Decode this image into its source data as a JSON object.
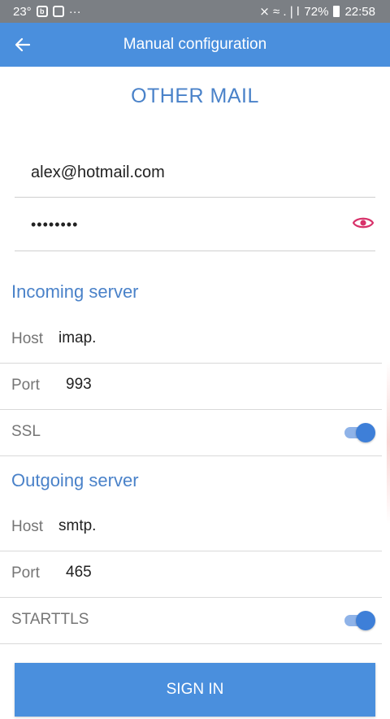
{
  "status_bar": {
    "temperature": "23°",
    "dots": "···",
    "signal": "⨯ ≈ .❘l",
    "battery": "72%",
    "time": "22:58"
  },
  "app_bar": {
    "back_icon": "arrow-left-icon",
    "title": "Manual configuration"
  },
  "heading": "OTHER MAIL",
  "account": {
    "email": "alex@hotmail.com",
    "password_masked": "••••••••",
    "eye_icon": "eye-icon"
  },
  "incoming": {
    "title": "Incoming server",
    "host_label": "Host",
    "host_value": "imap.",
    "port_label": "Port",
    "port_value": "993",
    "ssl_label": "SSL",
    "ssl_on": true
  },
  "outgoing": {
    "title": "Outgoing server",
    "host_label": "Host",
    "host_value": "smtp.",
    "port_label": "Port",
    "port_value": "465",
    "starttls_label": "STARTTLS",
    "starttls_on": true
  },
  "sign_in_label": "SIGN IN",
  "colors": {
    "accent": "#4a8fdd",
    "heading": "#4a82c9",
    "eye": "#d8326a"
  }
}
